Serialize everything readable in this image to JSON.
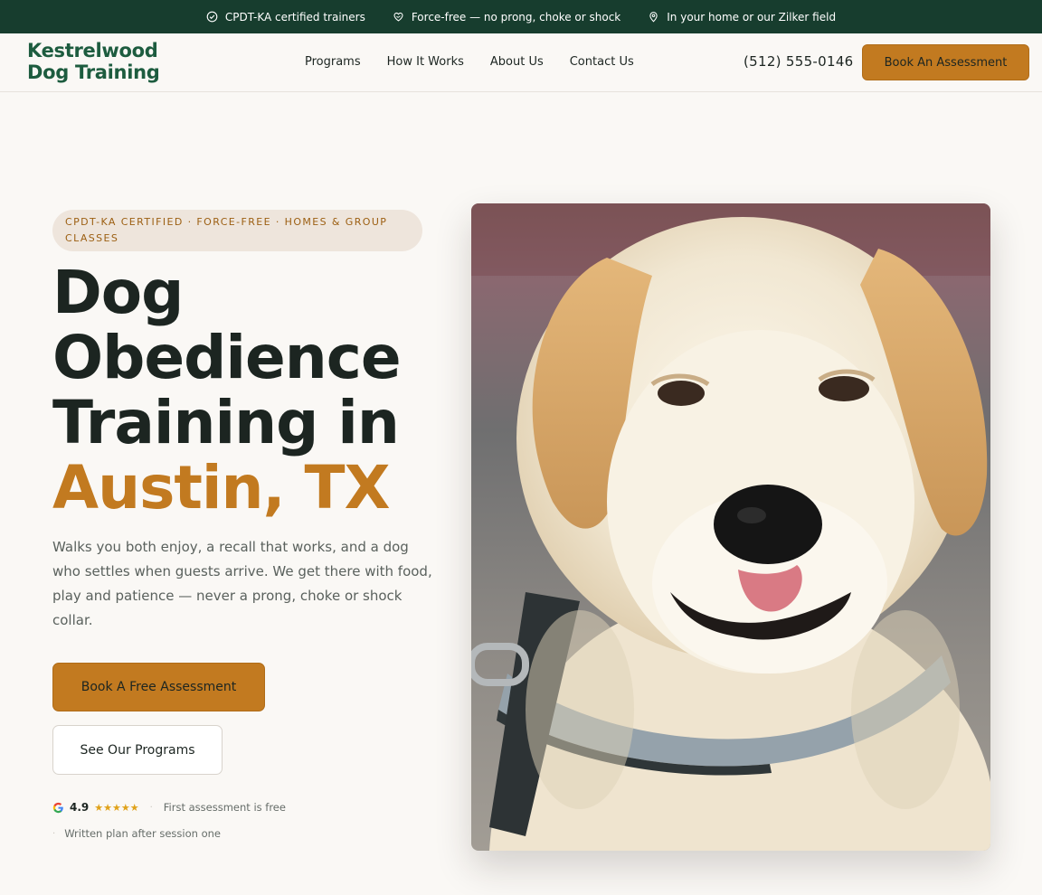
{
  "topbar": {
    "items": [
      {
        "icon": "check-circle-icon",
        "text": "CPDT-KA certified trainers"
      },
      {
        "icon": "heart-hand-icon",
        "text": "Force-free — no prong, choke or shock"
      },
      {
        "icon": "map-pin-icon",
        "text": "In your home or our Zilker field"
      }
    ]
  },
  "header": {
    "logo_line1": "Kestrelwood",
    "logo_line2": "Dog Training",
    "nav": [
      "Programs",
      "How It Works",
      "About Us",
      "Contact Us"
    ],
    "phone": "(512) 555-0146",
    "cta": "Book An Assessment"
  },
  "hero": {
    "eyebrow": "CPDT-KA certified · force-free · homes & group classes",
    "headline_line1": "Dog",
    "headline_line2": "Obedience",
    "headline_line3": "Training in",
    "headline_accent": "Austin, TX",
    "lede": "Walks you both enjoy, a recall that works, and a dog who settles when guests arrive. We get there with food, play and patience — never a prong, choke or shock collar.",
    "primary_cta": "Book A Free Assessment",
    "secondary_cta": "See Our Programs",
    "rating": "4.9",
    "stars": "★★★★★",
    "proof1": "First assessment is free",
    "proof2": "Written plan after session one"
  },
  "colors": {
    "brand_green": "#173d2e",
    "logo_green": "#1d5c3f",
    "accent_orange": "#c27a20",
    "background": "#faf8f5"
  }
}
